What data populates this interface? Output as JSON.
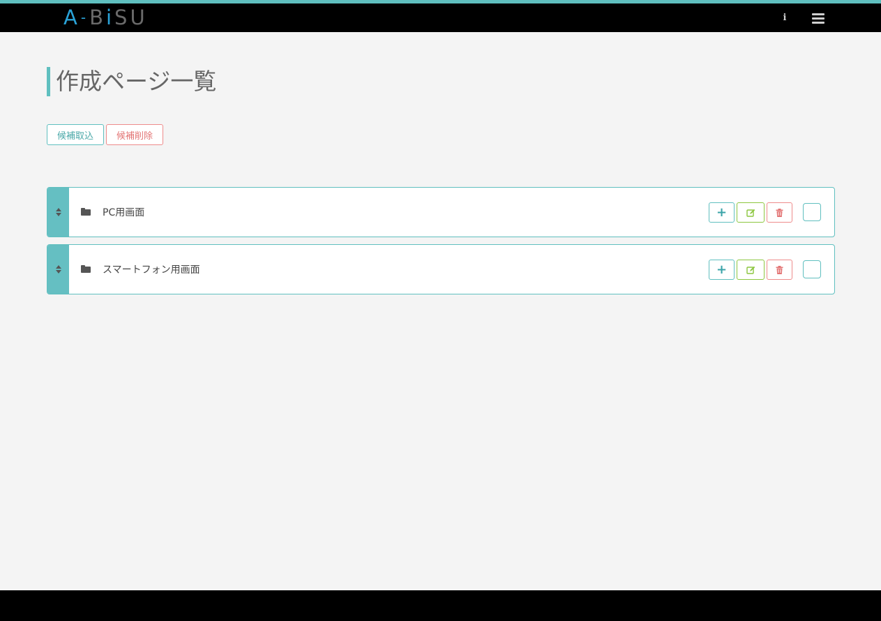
{
  "app": {
    "logo_part1": "A",
    "logo_part2": "-",
    "logo_part3": "B",
    "logo_part4": "i",
    "logo_part5": "SU"
  },
  "header": {
    "info_icon": "info-icon",
    "info_glyph": "i",
    "menu_icon": "hamburger-menu-icon"
  },
  "page": {
    "title": "作成ページ一覧"
  },
  "toolbar": {
    "import_label": "候補取込",
    "delete_label": "候補削除"
  },
  "folders": [
    {
      "name": "PC用画面"
    },
    {
      "name": "スマートフォン用画面"
    }
  ],
  "row_actions": {
    "add_glyph": "+",
    "add_icon": "plus-icon",
    "edit_icon": "edit-icon",
    "delete_icon": "trash-icon"
  },
  "colors": {
    "accent": "#5fbfbf",
    "handle": "#65bfc2",
    "edit": "#8cc63f",
    "danger": "#ee8b8b",
    "logo_blue": "#2aa3d8"
  }
}
